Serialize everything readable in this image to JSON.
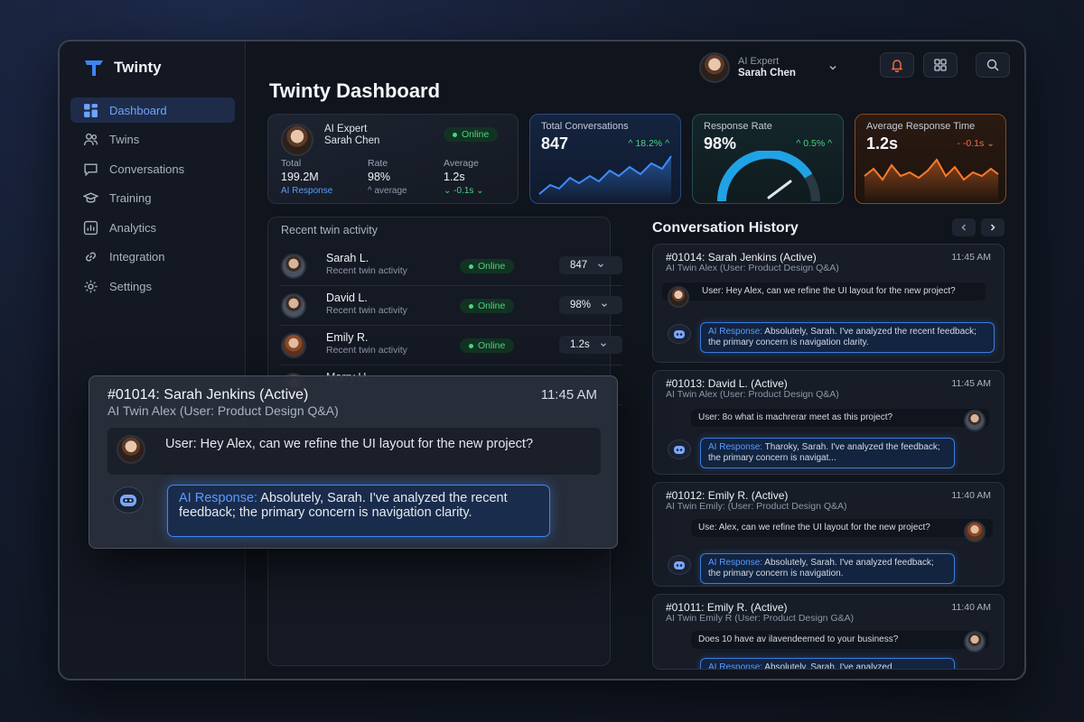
{
  "app": {
    "name": "Twinty",
    "page_title": "Twinty Dashboard"
  },
  "sidebar": {
    "items": [
      {
        "label": "Dashboard",
        "icon": "dashboard-icon",
        "active": true
      },
      {
        "label": "Twins",
        "icon": "users-icon"
      },
      {
        "label": "Conversations",
        "icon": "chat-icon"
      },
      {
        "label": "Training",
        "icon": "graduation-cap-icon"
      },
      {
        "label": "Analytics",
        "icon": "bar-chart-icon"
      },
      {
        "label": "Integration",
        "icon": "link-icon"
      },
      {
        "label": "Settings",
        "icon": "gear-icon"
      }
    ]
  },
  "header": {
    "user": {
      "role": "AI Expert",
      "name": "Sarah Chen"
    },
    "icons": [
      "bell-icon",
      "grid-icon",
      "search-icon"
    ]
  },
  "profile_card": {
    "role": "AI Expert",
    "name": "Sarah Chen",
    "status": "Online",
    "stats": [
      {
        "label": "Total",
        "value": "199.2M",
        "sub": "AI Response"
      },
      {
        "label": "Rate",
        "value": "98%",
        "sub": "^ average"
      },
      {
        "label": "Average",
        "value": "1.2s",
        "sub": "⌄ -0.1s ⌄"
      }
    ]
  },
  "stat_cards": {
    "conversations": {
      "label": "Total Conversations",
      "value": "847",
      "delta": "^ 18.2% ^"
    },
    "response_rate": {
      "label": "Response Rate",
      "value": "98%",
      "delta": "^ 0.5% ^"
    },
    "avg_time": {
      "label": "Average Response Time",
      "value": "1.2s",
      "delta": "- -0.1s ⌄"
    }
  },
  "activity": {
    "title": "Recent twin activity",
    "rows": [
      {
        "name": "Sarah L.",
        "desc": "Recent twin activity",
        "status": "Online",
        "value": "847"
      },
      {
        "name": "David L.",
        "desc": "Recent twin activity",
        "status": "Online",
        "value": "98%"
      },
      {
        "name": "Emily R.",
        "desc": "Recent twin activity",
        "status": "Online",
        "value": "1.2s"
      },
      {
        "name": "Marry H.",
        "desc": "",
        "status": "",
        "value": ""
      }
    ]
  },
  "history": {
    "title": "Conversation History",
    "items": [
      {
        "id": "#01014: Sarah Jenkins (Active)",
        "time": "11:45 AM",
        "sub": "AI Twin Alex (User: Product Design Q&A)",
        "user": "User: Hey Alex, can we refine the UI layout for the new project?",
        "ai_prefix": "AI Response:",
        "ai": " Absolutely, Sarah. I've analyzed the recent feedback; the primary concern is navigation clarity."
      },
      {
        "id": "#01013: David L.  (Active)",
        "time": "11:45 AM",
        "sub": "AI Twin Alex (User: Product Design Q&A)",
        "user": "User: 8o what is machrerar meet as this project?",
        "ai_prefix": "AI Response:",
        "ai": " Tharoky, Sarah. I've analyzed the feedback; the primary concern is navigat..."
      },
      {
        "id": "#01012: Emily R.  (Active)",
        "time": "11:40 AM",
        "sub": "AI Twin Emily: (User: Product Design Q&A)",
        "user": "Use: Alex, can we refine the UI layout for the new project?",
        "ai_prefix": "AI Response:",
        "ai": " Absolutely, Sarah. I've analyzed feedback; the primary concern is navigation."
      },
      {
        "id": "#01011: Emily R. (Active)",
        "time": "11:40 AM",
        "sub": "AI Twin Emily R (User: Product Design G&A)",
        "user": "Does  10 have av ilavendeemed to your business?",
        "ai_prefix": "AI Response:",
        "ai": " Absolutely, Sarah. I've analyzed"
      }
    ]
  },
  "overlay": {
    "id": "#01014: Sarah Jenkins (Active)",
    "time": "11:45 AM",
    "sub": "AI Twin Alex (User: Product Design Q&A)",
    "user": "User: Hey Alex, can we refine the UI layout for the new project?",
    "ai_prefix": "AI Response:",
    "ai": " Absolutely, Sarah. I've analyzed the recent feedback; the primary concern is navigation clarity."
  },
  "colors": {
    "accent": "#3f86f0",
    "online": "#4fd184",
    "conv_chart": "#3b8cff",
    "rate_gauge": "#1fa3e6",
    "avg_chart": "#ff7a2a"
  }
}
